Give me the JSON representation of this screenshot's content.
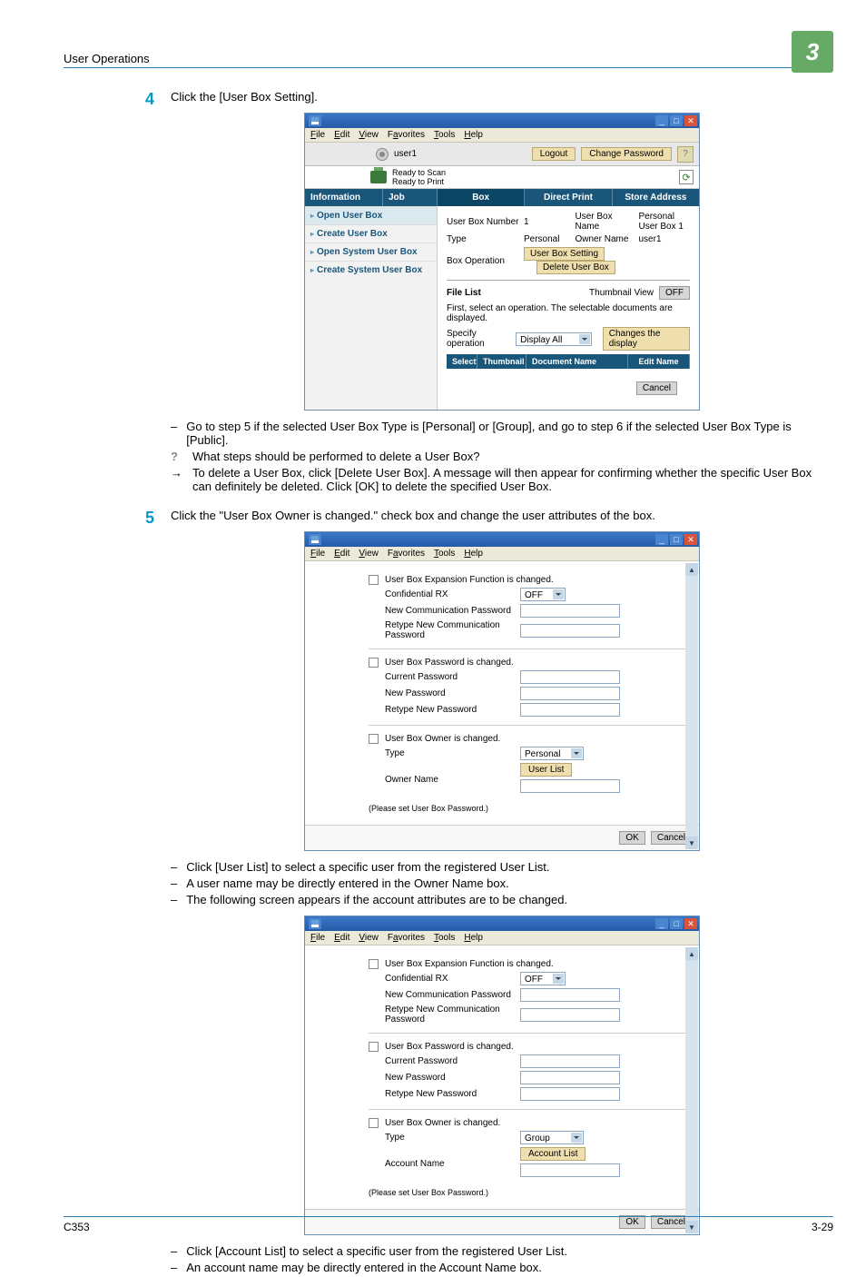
{
  "page": {
    "header_title": "User Operations",
    "chapter_number": "3",
    "footer_left": "C353",
    "footer_right": "3-29"
  },
  "step4": {
    "number": "4",
    "instruction": "Click the [User Box Setting].",
    "bullets": [
      "Go to step 5 if the selected User Box Type is [Personal] or [Group], and go to step 6 if the selected User Box Type is [Public]."
    ],
    "question": "What steps should be performed to delete a User Box?",
    "answer": "To delete a User Box, click [Delete User Box]. A message will then appear for confirming whether the specific User Box can definitely be deleted. Click [OK] to delete the specified User Box."
  },
  "step5": {
    "number": "5",
    "instruction": "Click the \"User Box Owner is changed.\" check box and change the user attributes of the box.",
    "bullets_after_dialog1": [
      "Click [User List] to select a specific user from the registered User List.",
      "A user name may be directly entered in the Owner Name box.",
      "The following screen appears if the account attributes are to be changed."
    ],
    "bullets_after_dialog2": [
      "Click [Account List] to select a specific user from the registered User List.",
      "An account name may be directly entered in the Account Name box."
    ]
  },
  "window_menu": [
    "File",
    "Edit",
    "View",
    "Favorites",
    "Tools",
    "Help"
  ],
  "screenshot1": {
    "user_label": "user1",
    "logout_btn": "Logout",
    "change_pw_btn": "Change Password",
    "help_btn": "?",
    "status": {
      "line1": "Ready to Scan",
      "line2": "Ready to Print"
    },
    "nav_cols": [
      "Information",
      "Job"
    ],
    "nav_tabs": [
      "Box",
      "Direct Print",
      "Store Address"
    ],
    "sidebar_items": [
      "Open User Box",
      "Create User Box",
      "Open System User Box",
      "Create System User Box"
    ],
    "kv": {
      "ub_number_lab": "User Box Number",
      "ub_number_val": "1",
      "ub_name_lab": "User Box Name",
      "ub_name_val": "Personal User Box 1",
      "type_lab": "Type",
      "type_val": "Personal",
      "owner_lab": "Owner Name",
      "owner_val": "user1",
      "boxop_lab": "Box Operation",
      "btn_setting": "User Box Setting",
      "btn_delete": "Delete User Box"
    },
    "filelist": {
      "title": "File List",
      "thumb_lab": "Thumbnail View",
      "thumb_btn": "OFF",
      "hint": "First, select an operation. The selectable documents are displayed.",
      "specify_lab": "Specify operation",
      "specify_val": "Display All",
      "changes_btn": "Changes the display",
      "th_select": "Select",
      "th_thumb": "Thumbnail",
      "th_name": "Document Name",
      "th_edit": "Edit Name",
      "cancel": "Cancel"
    }
  },
  "dialog_common": {
    "sec1_check": "User Box Expansion Function is changed.",
    "sec1_rows": {
      "conf_rx": "Confidential RX",
      "conf_rx_val": "OFF",
      "new_pw": "New Communication Password",
      "retype_pw": "Retype New Communication Password"
    },
    "sec2_check": "User Box Password is changed.",
    "sec2_rows": {
      "cur": "Current Password",
      "new": "New Password",
      "retype": "Retype New Password"
    },
    "sec3_check": "User Box Owner is changed.",
    "sec3_type_lab": "Type",
    "note": "(Please set User Box Password.)",
    "ok": "OK",
    "cancel": "Cancel"
  },
  "dialog1": {
    "type_val": "Personal",
    "owner_lab": "Owner Name",
    "list_btn": "User List"
  },
  "dialog2": {
    "type_val": "Group",
    "owner_lab": "Account Name",
    "list_btn": "Account List"
  }
}
